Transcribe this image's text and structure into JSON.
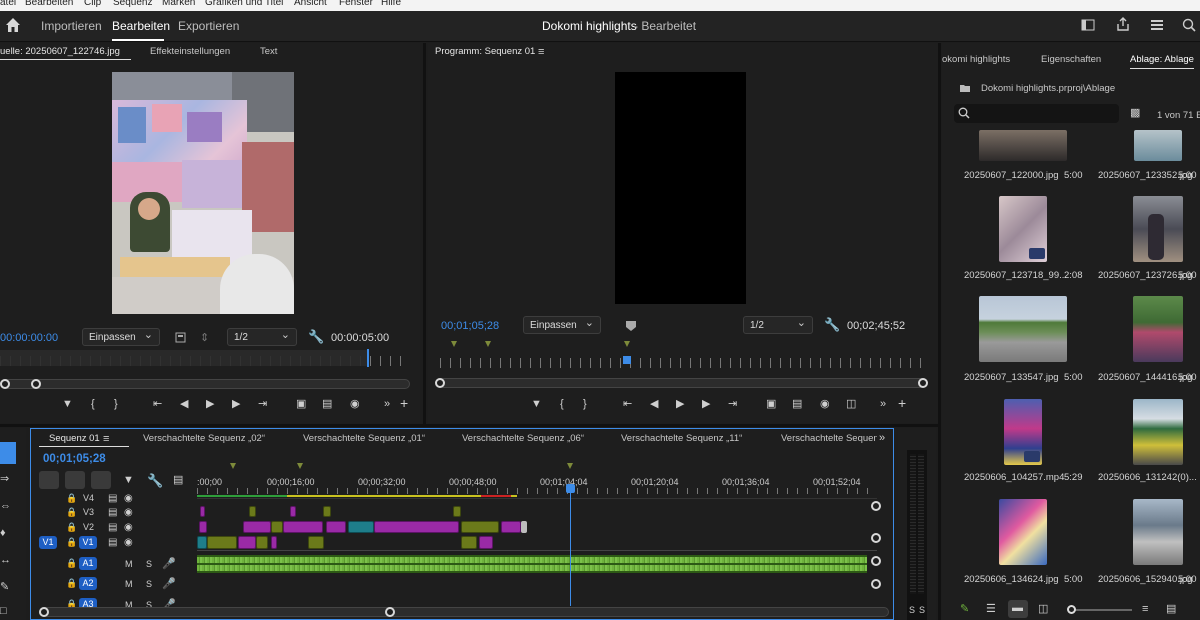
{
  "menu": [
    "atei",
    "Bearbeiten",
    "Clip",
    "Sequenz",
    "Marken",
    "Grafiken und Titel",
    "Ansicht",
    "Fenster",
    "Hilfe"
  ],
  "header": {
    "tabs": [
      "Importieren",
      "Bearbeiten",
      "Exportieren"
    ],
    "active": "Bearbeiten",
    "project": "Dokomi highlights",
    "state": "- Bearbeitet"
  },
  "source": {
    "tabs": [
      "uelle: 20250607_122746.jpg",
      "Effekteinstellungen",
      "Text"
    ],
    "timecode": "00:00:00:00",
    "fit": "Einpassen",
    "res": "1/2",
    "duration": "00:00:05:00"
  },
  "program": {
    "title": "Programm: Sequenz 01",
    "timecode": "00;01;05;28",
    "fit": "Einpassen",
    "res": "1/2",
    "duration": "00;02;45;52"
  },
  "timeline": {
    "tabs": [
      "Sequenz 01",
      "Verschachtelte Sequenz „02“",
      "Verschachtelte Sequenz „01“",
      "Verschachtelte Sequenz „06“",
      "Verschachtelte Sequenz „11“",
      "Verschachtelte Sequenz"
    ],
    "timecode": "00;01;05;28",
    "ruler": [
      ":00;00",
      "00;00;16;00",
      "00;00;32;00",
      "00;00;48;00",
      "00;01;04;04",
      "00;01;20;04",
      "00;01;36;04",
      "00;01;52;04"
    ],
    "video_tracks": [
      "V4",
      "V3",
      "V2",
      "V1"
    ],
    "audio_tracks": [
      "A1",
      "A2",
      "A3"
    ],
    "src_v": "V1",
    "m": "M",
    "s": "S"
  },
  "meter": {
    "labels": [
      "S",
      "S"
    ]
  },
  "bin": {
    "tabs": [
      "okomi highlights",
      "Eigenschaften",
      "Ablage: Ablage"
    ],
    "path": "Dokomi highlights.prproj\\Ablage",
    "count": "1 von 71 E",
    "items": [
      {
        "name": "20250607_122000.jpg",
        "dur": "5:00"
      },
      {
        "name": "20250607_123352.jpg",
        "dur": "5:00"
      },
      {
        "name": "20250607_123718_99...",
        "dur": "2:08"
      },
      {
        "name": "20250607_123726.jpg",
        "dur": "5:00"
      },
      {
        "name": "20250607_133547.jpg",
        "dur": "5:00"
      },
      {
        "name": "20250607_144416.jpg",
        "dur": "5:00"
      },
      {
        "name": "20250606_104257.mp4",
        "dur": "5:29"
      },
      {
        "name": "20250606_131242(0)...",
        "dur": ""
      },
      {
        "name": "20250606_134624.jpg",
        "dur": "5:00"
      },
      {
        "name": "20250606_152940.jpg",
        "dur": "5:00"
      }
    ]
  },
  "colors": {
    "accent": "#3d8ce8",
    "clip_purple": "#9a2aa6",
    "clip_olive": "#6b7a1a",
    "audio": "#6fb33d"
  }
}
